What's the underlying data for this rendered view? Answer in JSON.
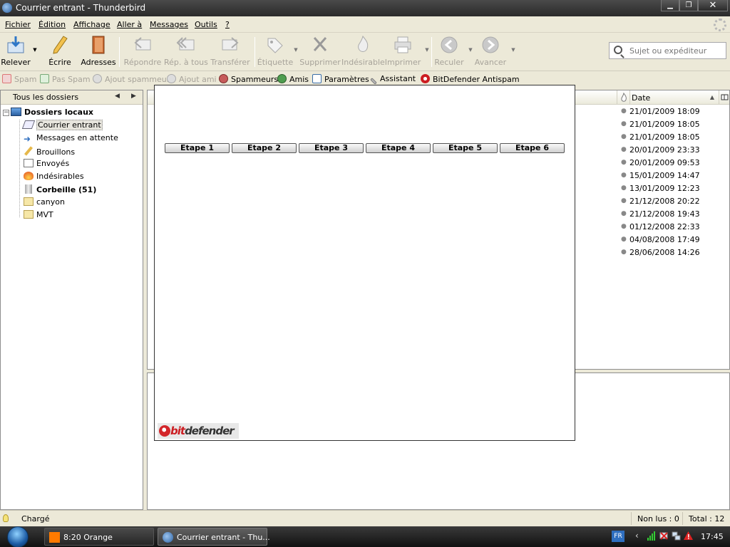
{
  "window": {
    "title": "Courrier entrant - Thunderbird"
  },
  "menu": [
    "Fichier",
    "Édition",
    "Affichage",
    "Aller à",
    "Messages",
    "Outils",
    "?"
  ],
  "toolbar": {
    "relever": "Relever",
    "ecrire": "Écrire",
    "adresses": "Adresses",
    "repondre": "Répondre",
    "rep_tous": "Rép. à tous",
    "transferer": "Transférer",
    "etiquette": "Étiquette",
    "supprimer": "Supprimer",
    "indesirable": "Indésirable",
    "imprimer": "Imprimer",
    "reculer": "Reculer",
    "avancer": "Avancer"
  },
  "search": {
    "placeholder": "Sujet ou expéditeur"
  },
  "antispam": {
    "spam": "Spam",
    "pas_spam": "Pas Spam",
    "ajout_spammeur": "Ajout spammeur",
    "ajout_ami": "Ajout ami",
    "spammeurs": "Spammeurs",
    "amis": "Amis",
    "parametres": "Paramètres",
    "assistant": "Assistant",
    "bitdefender": "BitDefender Antispam"
  },
  "folders": {
    "header": "Tous les dossiers",
    "root": "Dossiers locaux",
    "items": [
      {
        "label": "Courrier entrant",
        "icon": "inbox-icon"
      },
      {
        "label": "Messages en attente",
        "icon": "outbox-arrow-icon"
      },
      {
        "label": "Brouillons",
        "icon": "drafts-pencil-icon"
      },
      {
        "label": "Envoyés",
        "icon": "sent-envelope-icon"
      },
      {
        "label": "Indésirables",
        "icon": "junk-flame-icon"
      },
      {
        "label": "Corbeille (51)",
        "icon": "trash-icon"
      },
      {
        "label": "canyon",
        "icon": "folder-icon"
      },
      {
        "label": "MVT",
        "icon": "folder-icon"
      }
    ]
  },
  "thread": {
    "date_header": "Date",
    "dates": [
      "21/01/2009 18:09",
      "21/01/2009 18:05",
      "21/01/2009 18:05",
      "20/01/2009 23:33",
      "20/01/2009 09:53",
      "15/01/2009 14:47",
      "13/01/2009 12:23",
      "21/12/2008 20:22",
      "21/12/2008 19:43",
      "01/12/2008 22:33",
      "04/08/2008 17:49",
      "28/06/2008 14:26"
    ]
  },
  "popup": {
    "tabs": [
      "Etape 1",
      "Etape 2",
      "Etape 3",
      "Etape 4",
      "Etape 5",
      "Etape 6"
    ],
    "logo_part1": "bit",
    "logo_part2": "defender"
  },
  "status": {
    "text": "Chargé",
    "unread": "Non lus : 0",
    "total": "Total : 12"
  },
  "taskbar": {
    "tasks": [
      "8:20 Orange",
      "Courrier entrant - Thu..."
    ],
    "lang": "FR",
    "clock": "17:45"
  },
  "colors": {
    "bitdefender_red": "#cc1d22",
    "titlebar": "#2a2a2a",
    "chrome": "#ece9d8"
  }
}
